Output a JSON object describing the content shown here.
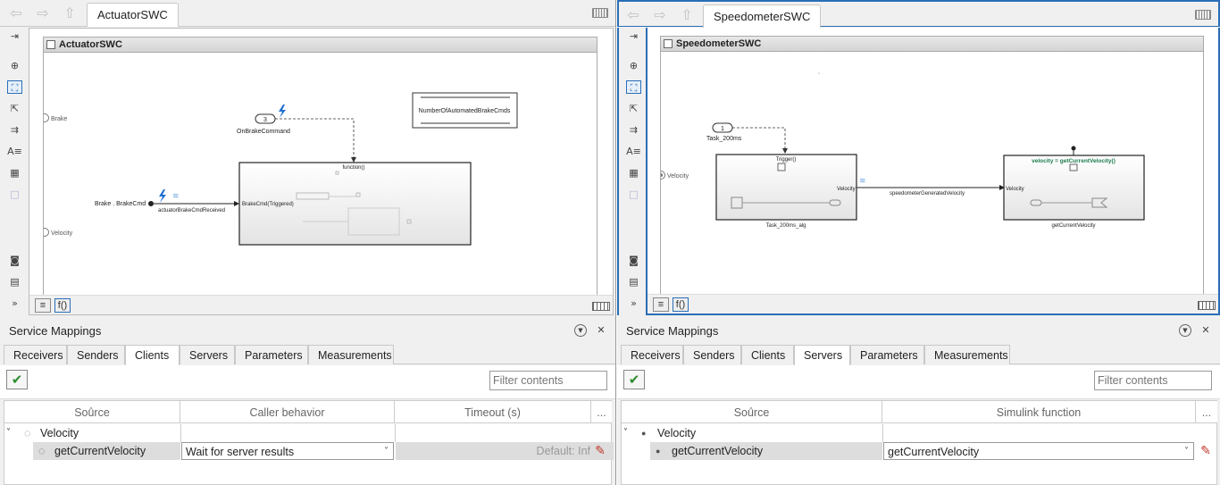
{
  "left": {
    "tab_title": "ActuatorSWC",
    "model_title": "ActuatorSWC",
    "diagram": {
      "inport_brake": "Brake",
      "inport_velocity": "Velocity",
      "trigger_number": "3",
      "trigger_name": "OnBrakeCommand",
      "function_label": "function()",
      "brake_cmd_source": "Brake . BrakeCmd",
      "signal_name": "actuatorBrakeCmdReceived",
      "subsystem_port": "BrakeCmd(Triggered)",
      "data_store": "NumberOfAutomatedBrakeCmds"
    },
    "status_fx": "f()",
    "mapping": {
      "title": "Service Mappings",
      "tabs": [
        "Receivers",
        "Senders",
        "Clients",
        "Servers",
        "Parameters",
        "Measurements"
      ],
      "active_tab": "Clients",
      "filter_placeholder": "Filter contents",
      "columns": [
        "Source",
        "Caller behavior",
        "Timeout (s)",
        "..."
      ],
      "rows": [
        {
          "source": "Velocity",
          "behavior": "",
          "timeout": ""
        },
        {
          "source": "getCurrentVelocity",
          "behavior": "Wait for server results",
          "timeout": "Default: Inf"
        }
      ]
    }
  },
  "right": {
    "tab_title": "SpeedometerSWC",
    "model_title": "SpeedometerSWC",
    "diagram": {
      "trigger_number": "1",
      "trigger_name": "Task_200ms",
      "trigger_port": "Trigger()",
      "inport_velocity": "Velocity",
      "alg_out_port": "Velocity",
      "alg_name": "Task_200ms_alg",
      "signal_name": "speedometerGeneratedVelocity",
      "func_in_port": "Velocity",
      "func_signature": "velocity = getCurrentVelocity()",
      "func_name": "getCurrentVelocity"
    },
    "status_fx": "f()",
    "mapping": {
      "title": "Service Mappings",
      "tabs": [
        "Receivers",
        "Senders",
        "Clients",
        "Servers",
        "Parameters",
        "Measurements"
      ],
      "active_tab": "Servers",
      "filter_placeholder": "Filter contents",
      "columns": [
        "Source",
        "Simulink function",
        "..."
      ],
      "rows": [
        {
          "source": "Velocity",
          "function": ""
        },
        {
          "source": "getCurrentVelocity",
          "function": "getCurrentVelocity"
        }
      ]
    }
  },
  "icons": {
    "back": "back-arrow-icon",
    "forward": "forward-arrow-icon",
    "up": "up-arrow-icon",
    "keyboard": "keyboard-icon",
    "collapse": "collapse-icon",
    "close": "close-icon",
    "apply": "checkmark-icon",
    "edit": "pencil-icon"
  },
  "colors": {
    "accent": "#2a6eb7",
    "apply_green": "#2e8b2e",
    "trigger_blue": "#1f6fd0",
    "function_green": "#1a7a4a"
  }
}
